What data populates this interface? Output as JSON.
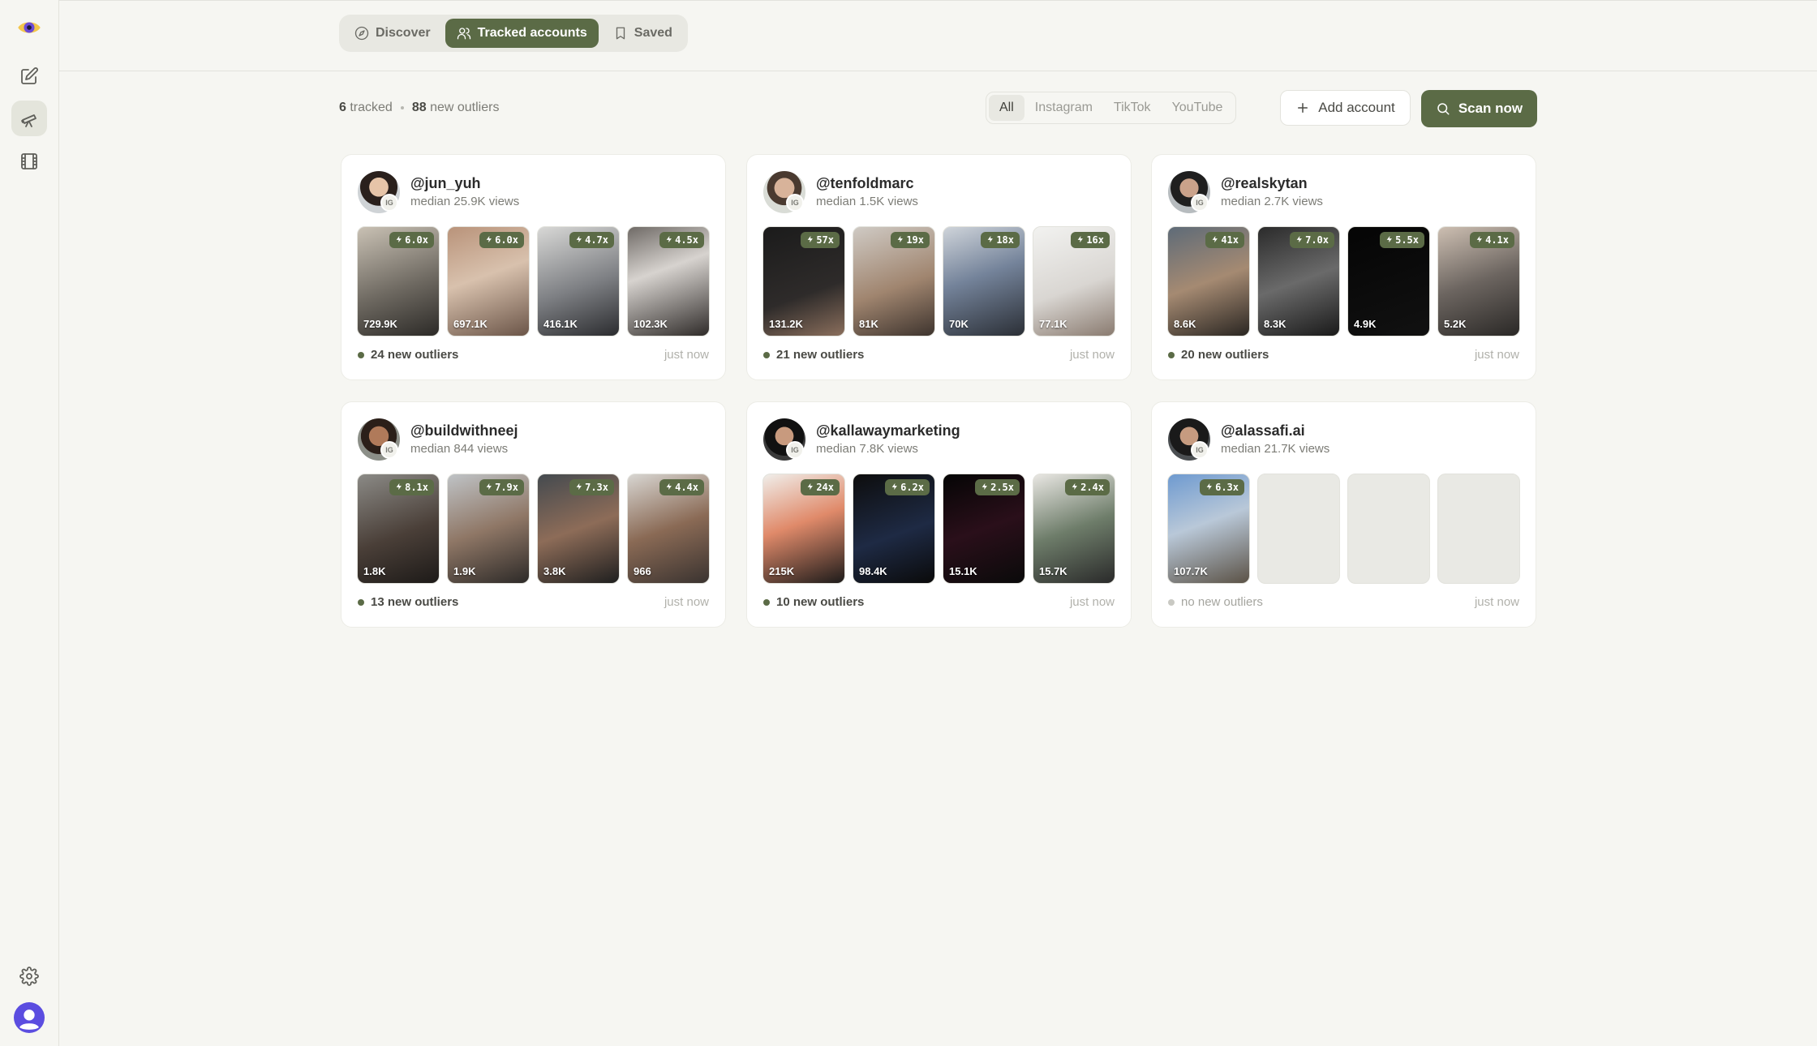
{
  "nav": {
    "tabs": [
      {
        "label": "Discover",
        "icon": "compass-icon",
        "active": false
      },
      {
        "label": "Tracked accounts",
        "icon": "users-icon",
        "active": true
      },
      {
        "label": "Saved",
        "icon": "bookmark-icon",
        "active": false
      }
    ]
  },
  "sidebar": {
    "items": [
      {
        "name": "logo",
        "icon": "eye-logo-icon"
      },
      {
        "name": "editor",
        "icon": "edit-icon"
      },
      {
        "name": "tracking",
        "icon": "telescope-icon",
        "active": true
      },
      {
        "name": "library",
        "icon": "film-icon"
      },
      {
        "name": "settings",
        "icon": "gear-icon"
      },
      {
        "name": "profile",
        "icon": "avatar-icon"
      }
    ]
  },
  "summary": {
    "tracked_count": "6",
    "tracked_label": "tracked",
    "outliers_count": "88",
    "outliers_label": "new outliers"
  },
  "filters": [
    "All",
    "Instagram",
    "TikTok",
    "YouTube"
  ],
  "active_filter": "All",
  "actions": {
    "add_label": "Add account",
    "scan_label": "Scan now"
  },
  "colors": {
    "accent": "#5b6b46",
    "background": "#f6f6f2",
    "card": "#ffffff"
  },
  "accounts": [
    {
      "handle": "@jun_yuh",
      "median": "median 25.9K views",
      "platform": "IG",
      "posts": [
        {
          "multiplier": "6.0x",
          "views": "729.9K"
        },
        {
          "multiplier": "6.0x",
          "views": "697.1K"
        },
        {
          "multiplier": "4.7x",
          "views": "416.1K"
        },
        {
          "multiplier": "4.5x",
          "views": "102.3K"
        }
      ],
      "outliers": "24 new outliers",
      "updated": "just now"
    },
    {
      "handle": "@tenfoldmarc",
      "median": "median 1.5K views",
      "platform": "IG",
      "posts": [
        {
          "multiplier": "57x",
          "views": "131.2K"
        },
        {
          "multiplier": "19x",
          "views": "81K"
        },
        {
          "multiplier": "18x",
          "views": "70K"
        },
        {
          "multiplier": "16x",
          "views": "77.1K"
        }
      ],
      "outliers": "21 new outliers",
      "updated": "just now"
    },
    {
      "handle": "@realskytan",
      "median": "median 2.7K views",
      "platform": "IG",
      "posts": [
        {
          "multiplier": "41x",
          "views": "8.6K"
        },
        {
          "multiplier": "7.0x",
          "views": "8.3K"
        },
        {
          "multiplier": "5.5x",
          "views": "4.9K"
        },
        {
          "multiplier": "4.1x",
          "views": "5.2K"
        }
      ],
      "outliers": "20 new outliers",
      "updated": "just now"
    },
    {
      "handle": "@buildwithneej",
      "median": "median 844 views",
      "platform": "IG",
      "posts": [
        {
          "multiplier": "8.1x",
          "views": "1.8K"
        },
        {
          "multiplier": "7.9x",
          "views": "1.9K"
        },
        {
          "multiplier": "7.3x",
          "views": "3.8K"
        },
        {
          "multiplier": "4.4x",
          "views": "966"
        }
      ],
      "outliers": "13 new outliers",
      "updated": "just now"
    },
    {
      "handle": "@kallawaymarketing",
      "median": "median 7.8K views",
      "platform": "IG",
      "posts": [
        {
          "multiplier": "24x",
          "views": "215K"
        },
        {
          "multiplier": "6.2x",
          "views": "98.4K"
        },
        {
          "multiplier": "2.5x",
          "views": "15.1K"
        },
        {
          "multiplier": "2.4x",
          "views": "15.7K"
        }
      ],
      "outliers": "10 new outliers",
      "updated": "just now"
    },
    {
      "handle": "@alassafi.ai",
      "median": "median 21.7K views",
      "platform": "IG",
      "posts": [
        {
          "multiplier": "6.3x",
          "views": "107.7K"
        }
      ],
      "outliers": "no new outliers",
      "updated": "just now"
    }
  ]
}
